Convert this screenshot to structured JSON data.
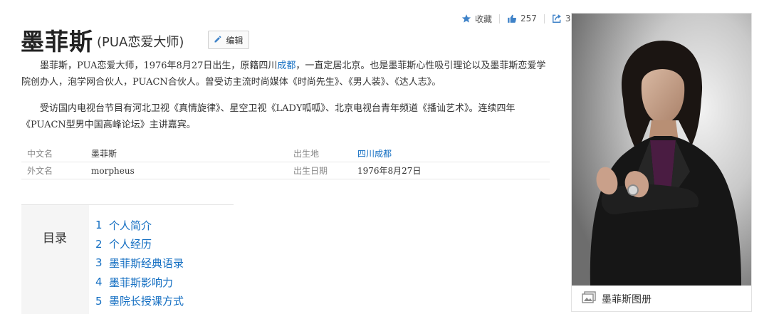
{
  "actions": {
    "collect_label": "收藏",
    "like_count": "257",
    "share_count": "3"
  },
  "header": {
    "title": "墨菲斯",
    "subtitle": "(PUA恋爱大师)",
    "edit_label": "编辑"
  },
  "summary": {
    "p1_a": "墨菲斯，PUA恋爱大师，1976年8月27日出生，原籍四川",
    "p1_link": "成都",
    "p1_b": "，一直定居北京。也是墨菲斯心性吸引理论以及墨菲斯恋爱学院创办人，泡学网合伙人，PUACN合伙人。曾受访主流时尚媒体《时尚先生》、《男人装》、《达人志》。",
    "p2": "受访国内电视台节目有河北卫视《真情旋律》、星空卫视《LADY呱呱》、北京电视台青年频道《播讪艺术》。连续四年《PUACN型男中国高峰论坛》主讲嘉宾。"
  },
  "basic_info": [
    {
      "k1": "中文名",
      "v1": "墨菲斯",
      "k2": "出生地",
      "v2": "四川成都"
    },
    {
      "k1": "外文名",
      "v1": "morpheus",
      "k2": "出生日期",
      "v2": "1976年8月27日"
    }
  ],
  "toc": {
    "label": "目录",
    "items": [
      {
        "num": "1",
        "text": "个人简介"
      },
      {
        "num": "2",
        "text": "个人经历"
      },
      {
        "num": "3",
        "text": "墨菲斯经典语录"
      },
      {
        "num": "4",
        "text": "墨菲斯影响力"
      },
      {
        "num": "5",
        "text": "墨院长授课方式"
      }
    ]
  },
  "album": {
    "label": "墨菲斯图册"
  },
  "colors": {
    "link": "#136ec2",
    "icon": "#3e82c8"
  },
  "icons": [
    "star-icon",
    "thumbs-up-icon",
    "share-icon",
    "pencil-icon",
    "album-icon"
  ]
}
